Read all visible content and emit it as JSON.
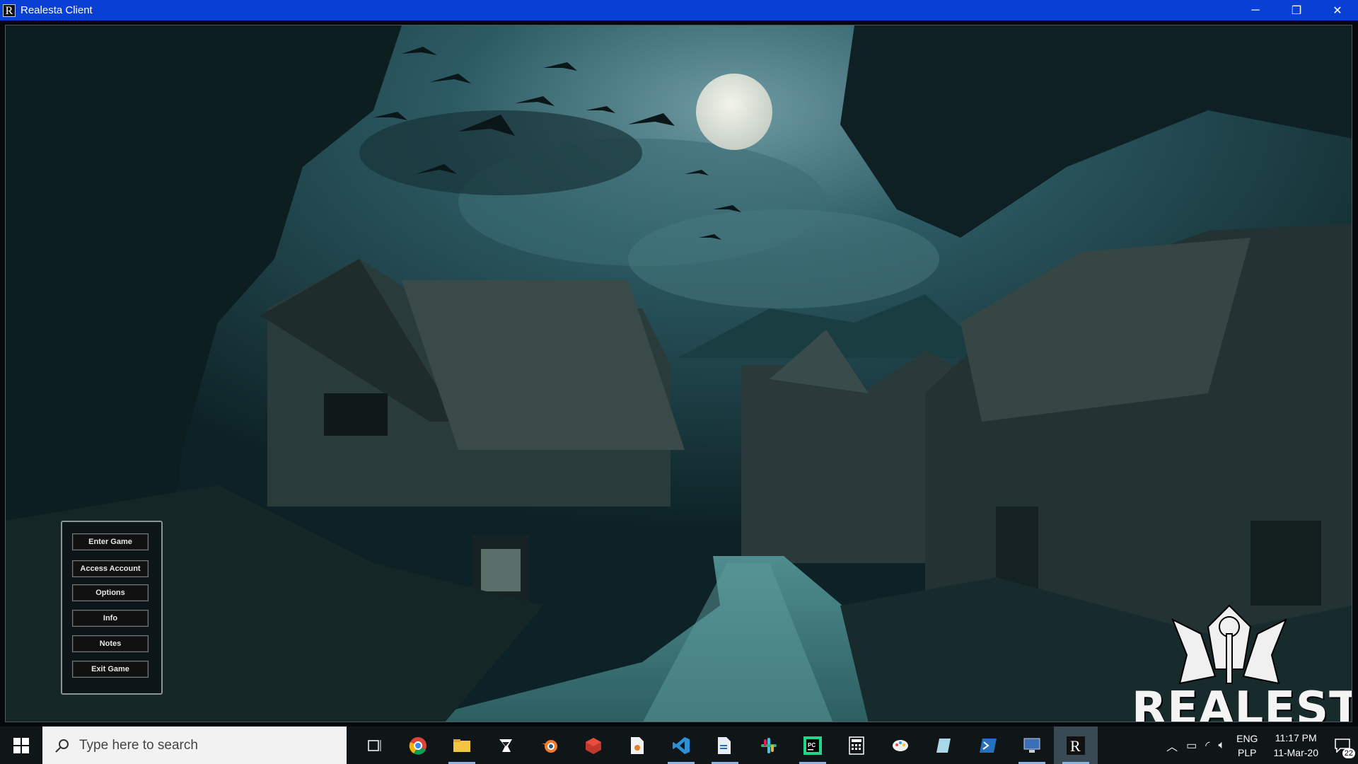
{
  "window": {
    "title": "Realesta Client",
    "icon_letter": "R",
    "minimize_glyph": "─",
    "restore_glyph": "❐",
    "close_glyph": "✕"
  },
  "menu": {
    "items": [
      {
        "label": "Enter Game"
      },
      {
        "label": "Access Account"
      },
      {
        "label": "Options"
      },
      {
        "label": "Info"
      },
      {
        "label": "Notes"
      },
      {
        "label": "Exit Game"
      }
    ]
  },
  "logo": {
    "text": "REALESTA"
  },
  "taskbar": {
    "search_placeholder": "Type here to search",
    "apps": [
      {
        "name": "task-view-icon"
      },
      {
        "name": "chrome-icon"
      },
      {
        "name": "file-explorer-icon"
      },
      {
        "name": "inkscape-icon"
      },
      {
        "name": "blender-icon"
      },
      {
        "name": "red-cube-app-icon"
      },
      {
        "name": "document-app-icon"
      },
      {
        "name": "vscode-icon"
      },
      {
        "name": "file-editor-icon"
      },
      {
        "name": "slack-icon"
      },
      {
        "name": "pycharm-icon"
      },
      {
        "name": "calculator-icon"
      },
      {
        "name": "paint-app-icon"
      },
      {
        "name": "notes-app-icon"
      },
      {
        "name": "powershell-icon"
      },
      {
        "name": "remote-desktop-icon"
      },
      {
        "name": "realesta-taskbar-icon"
      }
    ],
    "tray": {
      "lang_line1": "ENG",
      "lang_line2": "PLP",
      "time": "11:17 PM",
      "date": "11-Mar-20",
      "notifications": "22"
    }
  },
  "colors": {
    "titlebar": "#0a3fd6",
    "taskbar": "#101518",
    "scene_sky": "#1f4a55",
    "scene_dark": "#0b1a1d"
  }
}
